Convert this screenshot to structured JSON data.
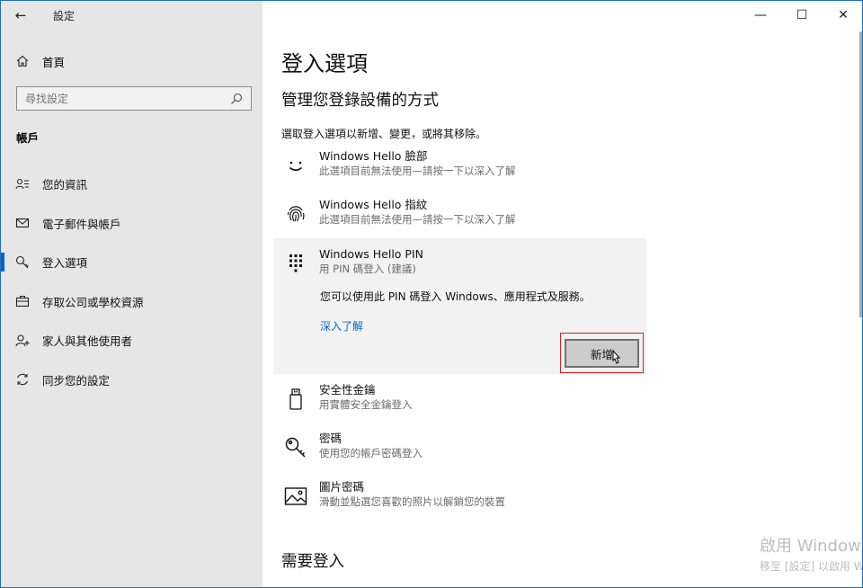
{
  "app": {
    "title": "設定"
  },
  "sidebar": {
    "home_label": "首頁",
    "search_placeholder": "尋找設定",
    "section_title": "帳戶",
    "items": [
      {
        "label": "您的資訊",
        "icon": "person-info-icon"
      },
      {
        "label": "電子郵件與帳戶",
        "icon": "mail-icon"
      },
      {
        "label": "登入選項",
        "icon": "key-icon",
        "active": true
      },
      {
        "label": "存取公司或學校資源",
        "icon": "briefcase-icon"
      },
      {
        "label": "家人與其他使用者",
        "icon": "person-add-icon"
      },
      {
        "label": "同步您的設定",
        "icon": "sync-icon"
      }
    ]
  },
  "window_controls": {
    "minimize": "—",
    "maximize": "☐",
    "close": "✕"
  },
  "main": {
    "title": "登入選項",
    "subtitle": "管理您登錄設備的方式",
    "description": "選取登入選項以新增、變更，或將其移除。",
    "options": [
      {
        "title": "Windows Hello 臉部",
        "subtitle": "此選項目前無法使用—請按一下以深入了解",
        "icon": "face-icon"
      },
      {
        "title": "Windows Hello 指紋",
        "subtitle": "此選項目前無法使用—請按一下以深入了解",
        "icon": "fingerprint-icon"
      },
      {
        "title": "Windows Hello PIN",
        "subtitle": "用 PIN 碼登入 (建議)",
        "icon": "pin-keypad-icon"
      },
      {
        "title": "安全性金鑰",
        "subtitle": "用實體安全金鑰登入",
        "icon": "usb-key-icon"
      },
      {
        "title": "密碼",
        "subtitle": "使用您的帳戶密碼登入",
        "icon": "password-key-icon"
      },
      {
        "title": "圖片密碼",
        "subtitle": "滑動並點選您喜歡的照片以解鎖您的裝置",
        "icon": "picture-icon"
      }
    ],
    "pin_detail": "您可以使用此 PIN 碼登入 Windows、應用程式及服務。",
    "pin_link": "深入了解",
    "add_button": "新增",
    "require_signin_title": "需要登入"
  },
  "watermark": {
    "line1": "啟用 Windows",
    "line2": "移至 [設定] 以啟用 W"
  },
  "colors": {
    "accent": "#0a64c8",
    "highlight_box": "#e02020",
    "sidebar_bg": "#e6e6e6",
    "panel_bg": "#f2f2f2"
  }
}
